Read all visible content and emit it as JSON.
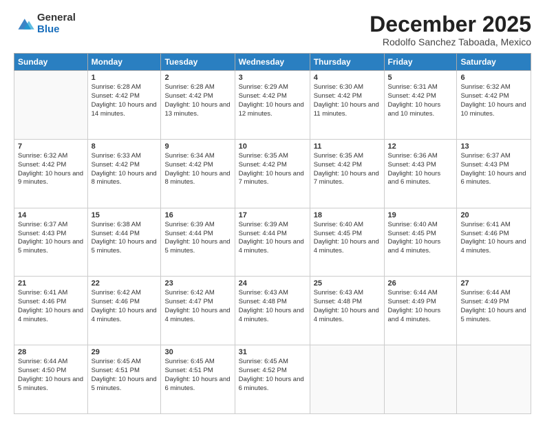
{
  "logo": {
    "general": "General",
    "blue": "Blue"
  },
  "header": {
    "title": "December 2025",
    "subtitle": "Rodolfo Sanchez Taboada, Mexico"
  },
  "days_of_week": [
    "Sunday",
    "Monday",
    "Tuesday",
    "Wednesday",
    "Thursday",
    "Friday",
    "Saturday"
  ],
  "weeks": [
    [
      {
        "day": "",
        "info": ""
      },
      {
        "day": "1",
        "info": "Sunrise: 6:28 AM\nSunset: 4:42 PM\nDaylight: 10 hours\nand 14 minutes."
      },
      {
        "day": "2",
        "info": "Sunrise: 6:28 AM\nSunset: 4:42 PM\nDaylight: 10 hours\nand 13 minutes."
      },
      {
        "day": "3",
        "info": "Sunrise: 6:29 AM\nSunset: 4:42 PM\nDaylight: 10 hours\nand 12 minutes."
      },
      {
        "day": "4",
        "info": "Sunrise: 6:30 AM\nSunset: 4:42 PM\nDaylight: 10 hours\nand 11 minutes."
      },
      {
        "day": "5",
        "info": "Sunrise: 6:31 AM\nSunset: 4:42 PM\nDaylight: 10 hours\nand 10 minutes."
      },
      {
        "day": "6",
        "info": "Sunrise: 6:32 AM\nSunset: 4:42 PM\nDaylight: 10 hours\nand 10 minutes."
      }
    ],
    [
      {
        "day": "7",
        "info": "Sunrise: 6:32 AM\nSunset: 4:42 PM\nDaylight: 10 hours\nand 9 minutes."
      },
      {
        "day": "8",
        "info": "Sunrise: 6:33 AM\nSunset: 4:42 PM\nDaylight: 10 hours\nand 8 minutes."
      },
      {
        "day": "9",
        "info": "Sunrise: 6:34 AM\nSunset: 4:42 PM\nDaylight: 10 hours\nand 8 minutes."
      },
      {
        "day": "10",
        "info": "Sunrise: 6:35 AM\nSunset: 4:42 PM\nDaylight: 10 hours\nand 7 minutes."
      },
      {
        "day": "11",
        "info": "Sunrise: 6:35 AM\nSunset: 4:42 PM\nDaylight: 10 hours\nand 7 minutes."
      },
      {
        "day": "12",
        "info": "Sunrise: 6:36 AM\nSunset: 4:43 PM\nDaylight: 10 hours\nand 6 minutes."
      },
      {
        "day": "13",
        "info": "Sunrise: 6:37 AM\nSunset: 4:43 PM\nDaylight: 10 hours\nand 6 minutes."
      }
    ],
    [
      {
        "day": "14",
        "info": "Sunrise: 6:37 AM\nSunset: 4:43 PM\nDaylight: 10 hours\nand 5 minutes."
      },
      {
        "day": "15",
        "info": "Sunrise: 6:38 AM\nSunset: 4:44 PM\nDaylight: 10 hours\nand 5 minutes."
      },
      {
        "day": "16",
        "info": "Sunrise: 6:39 AM\nSunset: 4:44 PM\nDaylight: 10 hours\nand 5 minutes."
      },
      {
        "day": "17",
        "info": "Sunrise: 6:39 AM\nSunset: 4:44 PM\nDaylight: 10 hours\nand 4 minutes."
      },
      {
        "day": "18",
        "info": "Sunrise: 6:40 AM\nSunset: 4:45 PM\nDaylight: 10 hours\nand 4 minutes."
      },
      {
        "day": "19",
        "info": "Sunrise: 6:40 AM\nSunset: 4:45 PM\nDaylight: 10 hours\nand 4 minutes."
      },
      {
        "day": "20",
        "info": "Sunrise: 6:41 AM\nSunset: 4:46 PM\nDaylight: 10 hours\nand 4 minutes."
      }
    ],
    [
      {
        "day": "21",
        "info": "Sunrise: 6:41 AM\nSunset: 4:46 PM\nDaylight: 10 hours\nand 4 minutes."
      },
      {
        "day": "22",
        "info": "Sunrise: 6:42 AM\nSunset: 4:46 PM\nDaylight: 10 hours\nand 4 minutes."
      },
      {
        "day": "23",
        "info": "Sunrise: 6:42 AM\nSunset: 4:47 PM\nDaylight: 10 hours\nand 4 minutes."
      },
      {
        "day": "24",
        "info": "Sunrise: 6:43 AM\nSunset: 4:48 PM\nDaylight: 10 hours\nand 4 minutes."
      },
      {
        "day": "25",
        "info": "Sunrise: 6:43 AM\nSunset: 4:48 PM\nDaylight: 10 hours\nand 4 minutes."
      },
      {
        "day": "26",
        "info": "Sunrise: 6:44 AM\nSunset: 4:49 PM\nDaylight: 10 hours\nand 4 minutes."
      },
      {
        "day": "27",
        "info": "Sunrise: 6:44 AM\nSunset: 4:49 PM\nDaylight: 10 hours\nand 5 minutes."
      }
    ],
    [
      {
        "day": "28",
        "info": "Sunrise: 6:44 AM\nSunset: 4:50 PM\nDaylight: 10 hours\nand 5 minutes."
      },
      {
        "day": "29",
        "info": "Sunrise: 6:45 AM\nSunset: 4:51 PM\nDaylight: 10 hours\nand 5 minutes."
      },
      {
        "day": "30",
        "info": "Sunrise: 6:45 AM\nSunset: 4:51 PM\nDaylight: 10 hours\nand 6 minutes."
      },
      {
        "day": "31",
        "info": "Sunrise: 6:45 AM\nSunset: 4:52 PM\nDaylight: 10 hours\nand 6 minutes."
      },
      {
        "day": "",
        "info": ""
      },
      {
        "day": "",
        "info": ""
      },
      {
        "day": "",
        "info": ""
      }
    ]
  ]
}
